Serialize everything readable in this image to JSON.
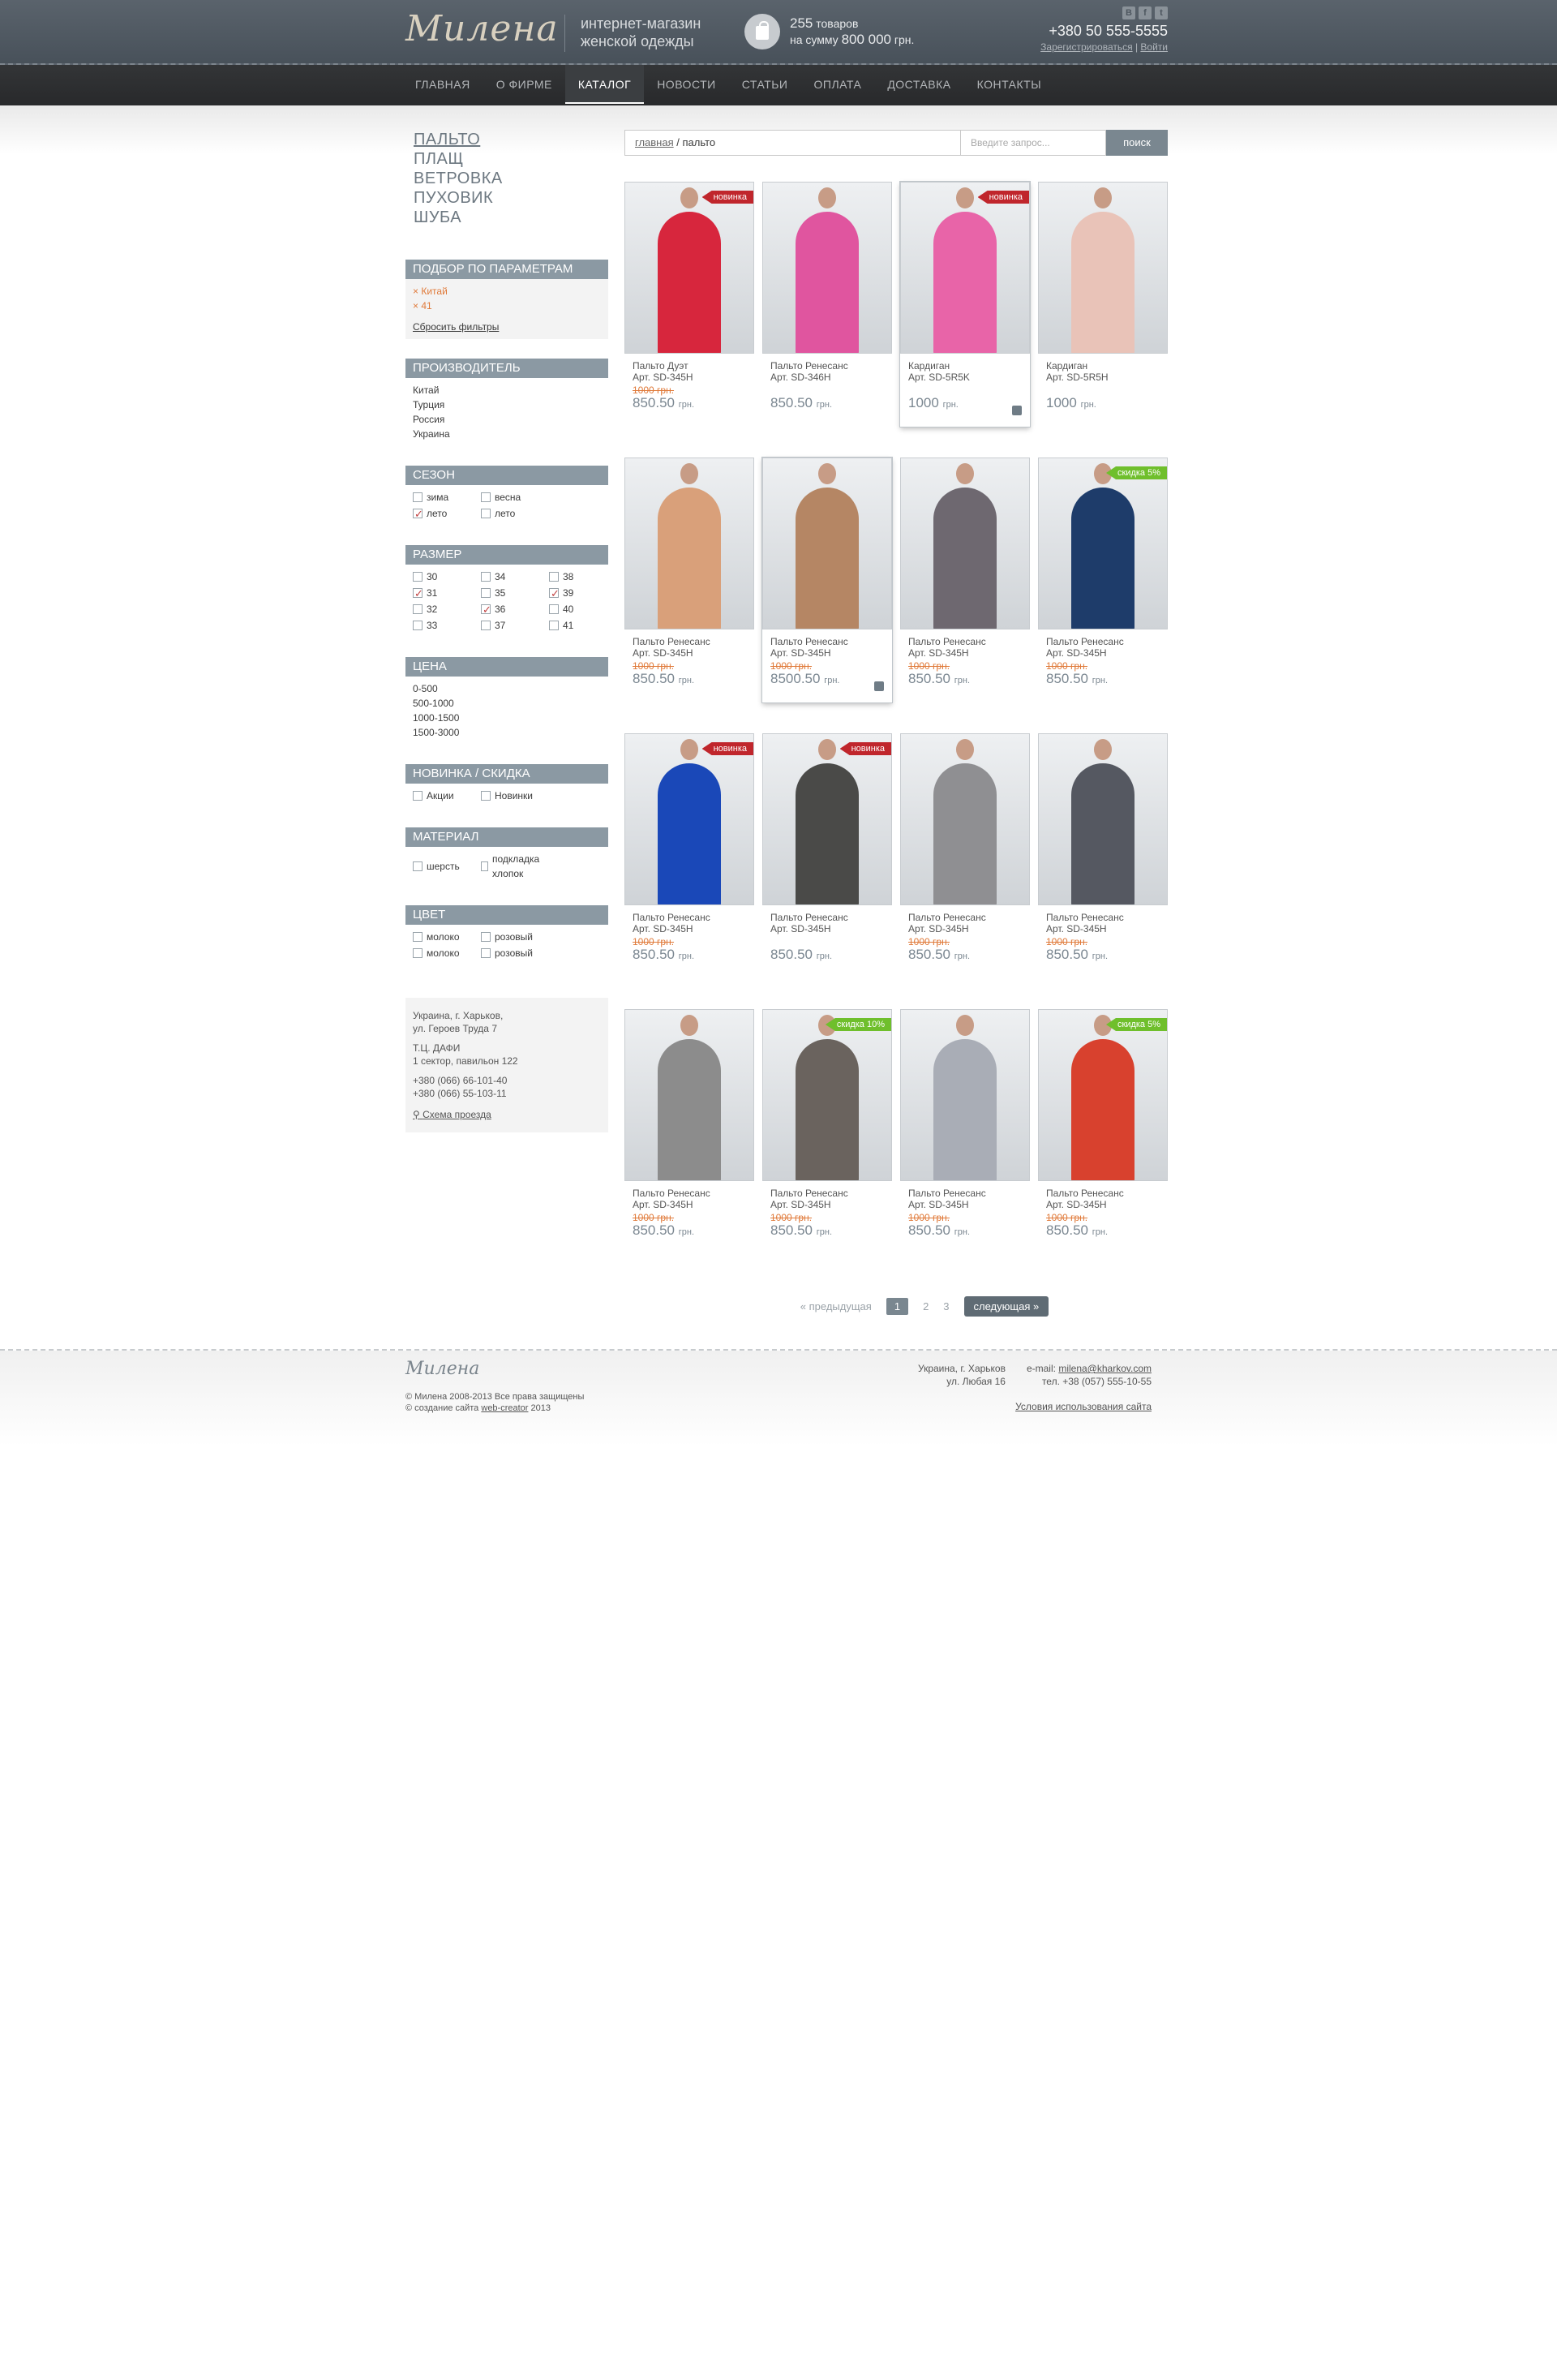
{
  "header": {
    "logo": "Милена",
    "tagline_1": "интернет-магазин",
    "tagline_2": "женской одежды",
    "cart_count": "255",
    "cart_count_label": "товаров",
    "cart_sum_prefix": "на сумму",
    "cart_sum": "800 000",
    "cart_currency": "грн.",
    "phone": "+380 50 555-5555",
    "register": "Зарегистрироваться",
    "login": "Войти",
    "social": [
      "В",
      "f",
      "t"
    ]
  },
  "nav": [
    "ГЛАВНАЯ",
    "О ФИРМЕ",
    "КАТАЛОГ",
    "НОВОСТИ",
    "СТАТЬИ",
    "ОПЛАТА",
    "ДОСТАВКА",
    "КОНТАКТЫ"
  ],
  "nav_active": "КАТАЛОГ",
  "categories": [
    "ПАЛЬТО",
    "ПЛАЩ",
    "ВЕТРОВКА",
    "ПУХОВИК",
    "ШУБА"
  ],
  "filters": {
    "title": "ПОДБОР ПО ПАРАМЕТРАМ",
    "selected": [
      "Китай",
      "41"
    ],
    "reset": "Сбросить фильтры"
  },
  "manufacturer": {
    "title": "ПРОИЗВОДИТЕЛЬ",
    "items": [
      "Китай",
      "Турция",
      "Россия",
      "Украина"
    ]
  },
  "season": {
    "title": "СЕЗОН",
    "items": [
      {
        "label": "зима",
        "checked": false
      },
      {
        "label": "весна",
        "checked": false
      },
      {
        "label": "лето",
        "checked": true
      },
      {
        "label": "лето",
        "checked": false
      }
    ]
  },
  "size": {
    "title": "РАЗМЕР",
    "items": [
      {
        "label": "30",
        "checked": false
      },
      {
        "label": "34",
        "checked": false
      },
      {
        "label": "38",
        "checked": false
      },
      {
        "label": "31",
        "checked": true
      },
      {
        "label": "35",
        "checked": false
      },
      {
        "label": "39",
        "checked": true
      },
      {
        "label": "32",
        "checked": false
      },
      {
        "label": "36",
        "checked": true
      },
      {
        "label": "40",
        "checked": false
      },
      {
        "label": "33",
        "checked": false
      },
      {
        "label": "37",
        "checked": false
      },
      {
        "label": "41",
        "checked": false
      }
    ]
  },
  "price": {
    "title": "ЦЕНА",
    "items": [
      "0-500",
      "500-1000",
      "1000-1500",
      "1500-3000"
    ]
  },
  "novelty": {
    "title": "НОВИНКА / СКИДКА",
    "items": [
      {
        "label": "Акции",
        "checked": false
      },
      {
        "label": "Новинки",
        "checked": false
      }
    ]
  },
  "material": {
    "title": "МАТЕРИАЛ",
    "items": [
      {
        "label": "шерсть",
        "checked": false
      },
      {
        "label": "подкладка хлопок",
        "checked": false
      }
    ]
  },
  "color": {
    "title": "ЦВЕТ",
    "items": [
      {
        "label": "молоко",
        "checked": false
      },
      {
        "label": "розовый",
        "checked": false
      },
      {
        "label": "молоко",
        "checked": false
      },
      {
        "label": "розовый",
        "checked": false
      }
    ]
  },
  "address": {
    "line1": "Украина, г. Харьков,",
    "line2": "ул. Героев Труда 7",
    "line3": "Т.Ц. ДАФИ",
    "line4": "1 сектор, павильон 122",
    "phone1": "+380 (066) 66-101-40",
    "phone2": "+380 (066) 55-103-11",
    "map": "Схема проезда"
  },
  "breadcrumb": {
    "home": "главная",
    "sep": "/",
    "current": "пальто"
  },
  "search": {
    "placeholder": "Введите запрос...",
    "button": "поиск"
  },
  "products": [
    {
      "name": "Пальто Дуэт",
      "art": "Арт. SD-345H",
      "old": "1000 грн.",
      "price": "850.50",
      "cur": "грн.",
      "badge": "новинка",
      "badge_color": "red",
      "coat": "#d7263d",
      "hover": false
    },
    {
      "name": "Пальто Ренесанс",
      "art": "Арт. SD-346H",
      "old": "",
      "price": "850.50",
      "cur": "грн.",
      "badge": "",
      "badge_color": "",
      "coat": "#e0559f",
      "hover": false
    },
    {
      "name": "Кардиган",
      "art": "Арт. SD-5R5K",
      "old": "",
      "price": "1000",
      "cur": "грн.",
      "badge": "новинка",
      "badge_color": "red",
      "coat": "#e864a8",
      "hover": true
    },
    {
      "name": "Кардиган",
      "art": "Арт. SD-5R5H",
      "old": "",
      "price": "1000",
      "cur": "грн.",
      "badge": "",
      "badge_color": "",
      "coat": "#e9c3b8",
      "hover": false
    },
    {
      "name": "Пальто Ренесанс",
      "art": "Арт. SD-345H",
      "old": "1000 грн.",
      "price": "850.50",
      "cur": "грн.",
      "badge": "",
      "badge_color": "",
      "coat": "#d9a07a",
      "hover": false
    },
    {
      "name": "Пальто Ренесанс",
      "art": "Арт. SD-345H",
      "old": "1000 грн.",
      "price": "8500.50",
      "cur": "грн.",
      "badge": "",
      "badge_color": "",
      "coat": "#b58664",
      "hover": true
    },
    {
      "name": "Пальто Ренесанс",
      "art": "Арт. SD-345H",
      "old": "1000 грн.",
      "price": "850.50",
      "cur": "грн.",
      "badge": "",
      "badge_color": "",
      "coat": "#6e6870",
      "hover": false
    },
    {
      "name": "Пальто Ренесанс",
      "art": "Арт. SD-345H",
      "old": "1000 грн.",
      "price": "850.50",
      "cur": "грн.",
      "badge": "скидка 5%",
      "badge_color": "green",
      "coat": "#1e3c6a",
      "hover": false
    },
    {
      "name": "Пальто Ренесанс",
      "art": "Арт. SD-345H",
      "old": "1000 грн.",
      "price": "850.50",
      "cur": "грн.",
      "badge": "новинка",
      "badge_color": "red",
      "coat": "#1a48b8",
      "hover": false
    },
    {
      "name": "Пальто Ренесанс",
      "art": "Арт. SD-345H",
      "old": "",
      "price": "850.50",
      "cur": "грн.",
      "badge": "новинка",
      "badge_color": "red",
      "coat": "#4a4a48",
      "hover": false
    },
    {
      "name": "Пальто Ренесанс",
      "art": "Арт. SD-345H",
      "old": "1000 грн.",
      "price": "850.50",
      "cur": "грн.",
      "badge": "",
      "badge_color": "",
      "coat": "#8f8f92",
      "hover": false
    },
    {
      "name": "Пальто Ренесанс",
      "art": "Арт. SD-345H",
      "old": "1000 грн.",
      "price": "850.50",
      "cur": "грн.",
      "badge": "",
      "badge_color": "",
      "coat": "#555861",
      "hover": false
    },
    {
      "name": "Пальто Ренесанс",
      "art": "Арт. SD-345H",
      "old": "1000 грн.",
      "price": "850.50",
      "cur": "грн.",
      "badge": "",
      "badge_color": "",
      "coat": "#8c8c8c",
      "hover": false
    },
    {
      "name": "Пальто Ренесанс",
      "art": "Арт. SD-345H",
      "old": "1000 грн.",
      "price": "850.50",
      "cur": "грн.",
      "badge": "скидка 10%",
      "badge_color": "green",
      "coat": "#6a635e",
      "hover": false
    },
    {
      "name": "Пальто Ренесанс",
      "art": "Арт. SD-345H",
      "old": "1000 грн.",
      "price": "850.50",
      "cur": "грн.",
      "badge": "",
      "badge_color": "",
      "coat": "#a9adb6",
      "hover": false
    },
    {
      "name": "Пальто Ренесанс",
      "art": "Арт. SD-345H",
      "old": "1000 грн.",
      "price": "850.50",
      "cur": "грн.",
      "badge": "скидка 5%",
      "badge_color": "green",
      "coat": "#d8412e",
      "hover": false
    }
  ],
  "pager": {
    "prev": "« предыдущая",
    "pages": [
      "1",
      "2",
      "3"
    ],
    "current": "1",
    "next": "следующая »"
  },
  "footer": {
    "logo": "Милена",
    "copy1": "© Милена 2008-2013 Все права защищены",
    "copy2_prefix": "© создание сайта",
    "copy2_link": "web-creator",
    "copy2_suffix": "2013",
    "addr1": "Украина, г. Харьков",
    "addr2": "ул. Любая 16",
    "email_label": "e-mail:",
    "email": "milena@kharkov.com",
    "tel": "тел. +38 (057) 555-10-55",
    "terms": "Условия использования сайта"
  }
}
